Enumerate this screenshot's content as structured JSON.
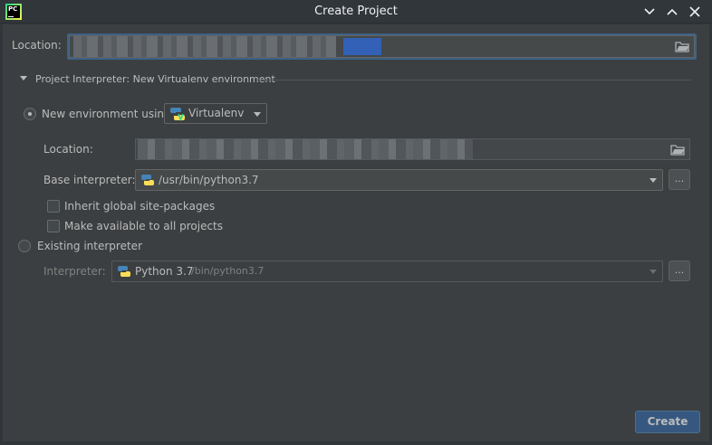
{
  "window": {
    "title": "Create Project",
    "controls": [
      "chevron-down-icon",
      "chevron-up-icon",
      "close-icon"
    ]
  },
  "app_icon_text": "PC",
  "location": {
    "label": "Location:"
  },
  "interpreter_section": {
    "header": "Project Interpreter: New Virtualenv environment",
    "new_env": {
      "radio_label": "New environment using",
      "selected": true,
      "tool": "Virtualenv",
      "location_label": "Location:",
      "base_label": "Base interpreter:",
      "base_value": "/usr/bin/python3.7",
      "inherit_label": "Inherit global site-packages",
      "inherit_checked": false,
      "available_label": "Make available to all projects",
      "available_checked": false,
      "browse_label": "..."
    },
    "existing": {
      "radio_label": "Existing interpreter",
      "selected": false,
      "interpreter_label": "Interpreter:",
      "interpreter_value": "Python 3.7",
      "interpreter_path": "/bin/python3.7",
      "browse_label": "..."
    }
  },
  "footer": {
    "create_label": "Create"
  },
  "colors": {
    "background": "#3c3f41",
    "titlebar": "#31363b",
    "accent": "#365880",
    "focus": "#3d6185",
    "text": "#bbbbbb"
  }
}
